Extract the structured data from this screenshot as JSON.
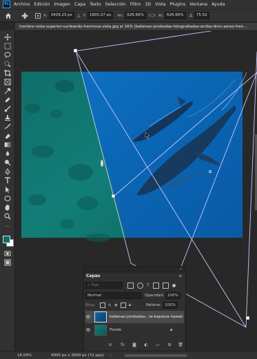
{
  "menubar": {
    "logo": "Ps",
    "items": [
      "Archivo",
      "Edición",
      "Imagen",
      "Capa",
      "Texto",
      "Selección",
      "Filtro",
      "3D",
      "Vista",
      "Plugins",
      "Ventana",
      "Ayuda"
    ]
  },
  "options": {
    "x_label": "X:",
    "x_value": "3429.23 px",
    "y_label": "Y:",
    "y_value": "1805.27 px",
    "an_label": "An:",
    "an_value": "626.66%",
    "al_label": "Al:",
    "al_value": "626.66%",
    "angle_value": "75.52"
  },
  "document": {
    "tab_title": "hombre-vista-superior-surfeando-hermosa-vista.jpg al 16% (ballenas-jorobadas-fotografiadas-arriba-dron-aereo-fren..."
  },
  "layers": {
    "tab": "Capas",
    "search_placeholder": "Tipo",
    "blend_mode": "Normal",
    "opacity_label": "Opacidad:",
    "opacity_value": "100%",
    "lock_label": "Bloq.:",
    "fill_label": "Relleno:",
    "fill_value": "100%",
    "items": [
      {
        "name": "ballenas-jorobadas...ta-kapalua-hawaii"
      },
      {
        "name": "Fondo"
      }
    ]
  },
  "status": {
    "zoom": "16.04%",
    "doc_info": "4000 px x 3000 px (72 ppp)"
  },
  "colors": {
    "foreground": "#0b6e6a",
    "background": "#ffffff",
    "ocean_blue": "#0b67b8",
    "teal_water": "#0f7f78"
  }
}
